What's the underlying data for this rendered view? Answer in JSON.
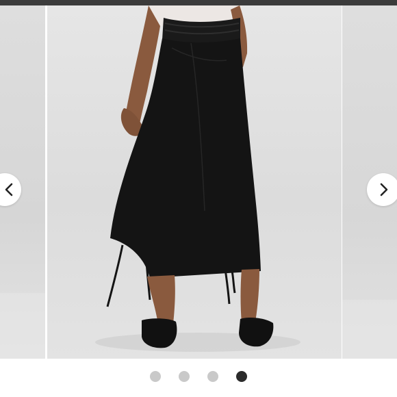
{
  "gallery": {
    "images": [
      {
        "alt": ""
      },
      {
        "alt": ""
      },
      {
        "alt": ""
      },
      {
        "alt": ""
      }
    ],
    "active_index": 3,
    "prev_icon": "chevron-left-icon",
    "next_icon": "chevron-right-icon"
  },
  "colors": {
    "topbar": "#3b3b3b",
    "dot_inactive": "#c9c9c9",
    "dot_active": "#2b2b2b",
    "skirt": "#141414"
  }
}
